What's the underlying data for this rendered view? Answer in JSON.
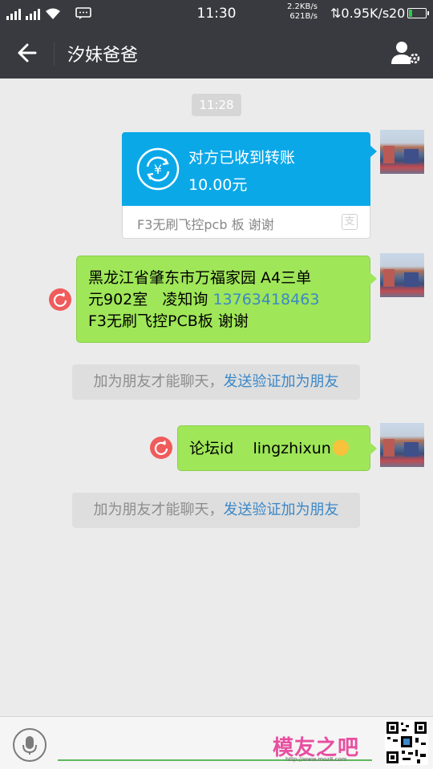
{
  "status_bar": {
    "time": "11:30",
    "net_up": "2.2KB/s",
    "net_down": "621B/s",
    "speed": "0.95K/s",
    "battery": "20",
    "battery_level_percent": 20
  },
  "header": {
    "title": "汐妹爸爸"
  },
  "chat": {
    "timestamp": "11:28",
    "transfer": {
      "title": "对方已收到转账",
      "amount": "10.00元",
      "note": "F3无刷飞控pcb 板 谢谢",
      "badge": "支",
      "color": "#0ba8e8"
    },
    "message1": {
      "line1": "黑龙江省肇东市万福家园 A4三单",
      "line2_prefix": "元902室   凌知询 ",
      "phone": "13763418463",
      "line3": "F3无刷飞控PCB板   谢谢",
      "failed": true
    },
    "system1": {
      "text": "加为朋友才能聊天，",
      "link": "发送验证加为朋友"
    },
    "message2": {
      "text": "论坛id    lingzhixun",
      "emoji": "smile-emoji",
      "failed": true
    },
    "system2": {
      "text": "加为朋友才能聊天，",
      "link": "发送验证加为朋友"
    }
  },
  "input_bar": {
    "voice_icon": "mic-icon"
  },
  "watermark": {
    "text": "模友之吧",
    "url": "http://www.moz8.com"
  },
  "colors": {
    "bar": "#393a3f",
    "bubble": "#9fe658",
    "link": "#3b88c8",
    "retry": "#f05b5b"
  }
}
